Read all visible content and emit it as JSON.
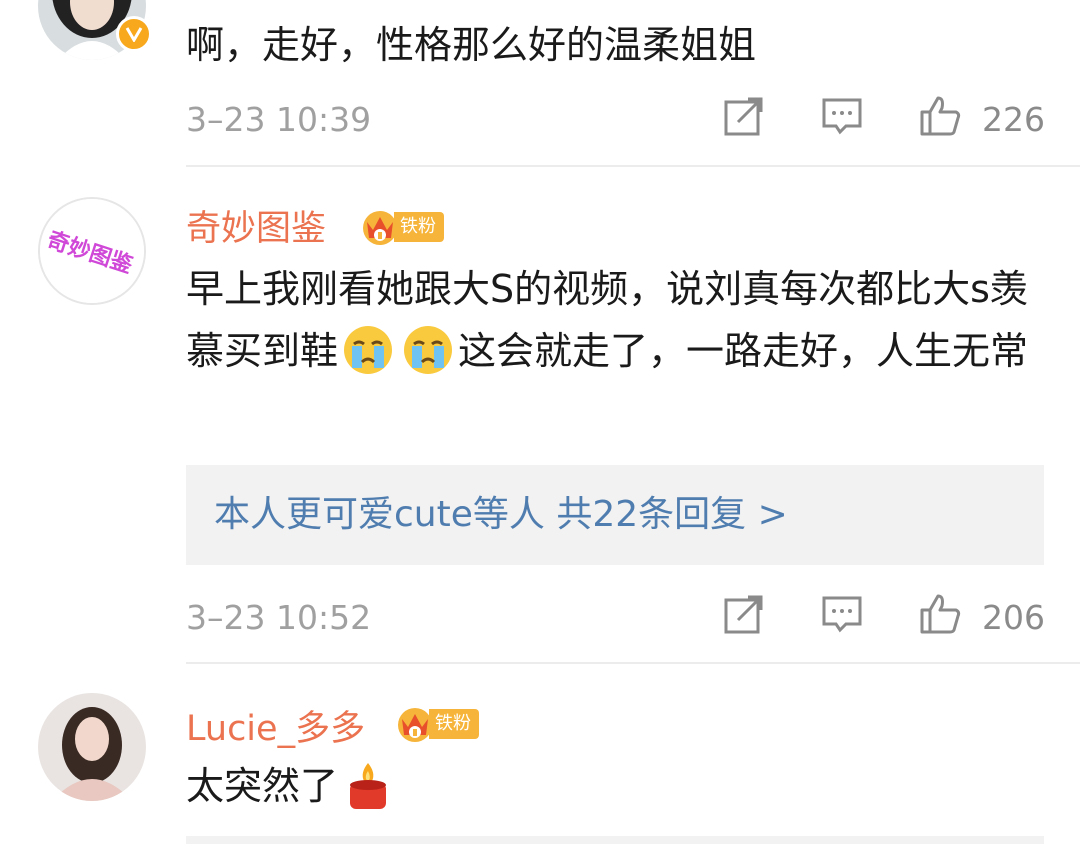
{
  "comments": [
    {
      "text": "啊，走好，性格那么好的温柔姐姐",
      "time": "3–23 10:39",
      "likes": "226"
    },
    {
      "name": "奇妙图鉴",
      "badge": "铁粉",
      "text_part1": "早上我刚看她跟大S的视频，说刘真每次都比大s羡慕买到鞋",
      "text_part2": "这会就走了，一路走好，人生无常",
      "emoji": [
        "crying-face-emoji",
        "crying-face-emoji"
      ],
      "avatar_text": "奇妙图鉴",
      "replies": "本人更可爱cute等人  共22条回复 >",
      "time": "3–23 10:52",
      "likes": "206"
    },
    {
      "name": "Lucie_多多",
      "badge": "铁粉",
      "text": "太突然了",
      "emoji": [
        "candle-emoji"
      ]
    }
  ],
  "colors": {
    "username": "#eb7350",
    "reply_link": "#507daf",
    "badge": "#f6b53a",
    "verified": "#f7a81c"
  },
  "icons": [
    "share-icon",
    "comment-icon",
    "thumbs-up-icon",
    "verified-icon",
    "crown-icon"
  ]
}
